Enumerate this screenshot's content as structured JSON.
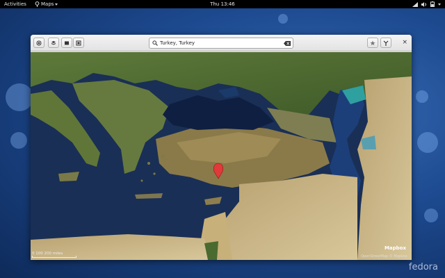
{
  "topbar": {
    "activities": "Activities",
    "app_name": "Maps",
    "clock": "Thu 13:46"
  },
  "window": {
    "search": {
      "value": "Turkey, Turkey"
    },
    "close_glyph": "×"
  },
  "map": {
    "scale_text": "0      100     200 miles",
    "provider": "Mapbox",
    "attribution": "OpenStreetMap © Mapbox"
  },
  "desktop": {
    "branding": "fedora"
  },
  "colors": {
    "marker": "#e03a3a",
    "sea": "#1a2f55",
    "land_green": "#4e6e32",
    "land_desert": "#c9b88a"
  }
}
